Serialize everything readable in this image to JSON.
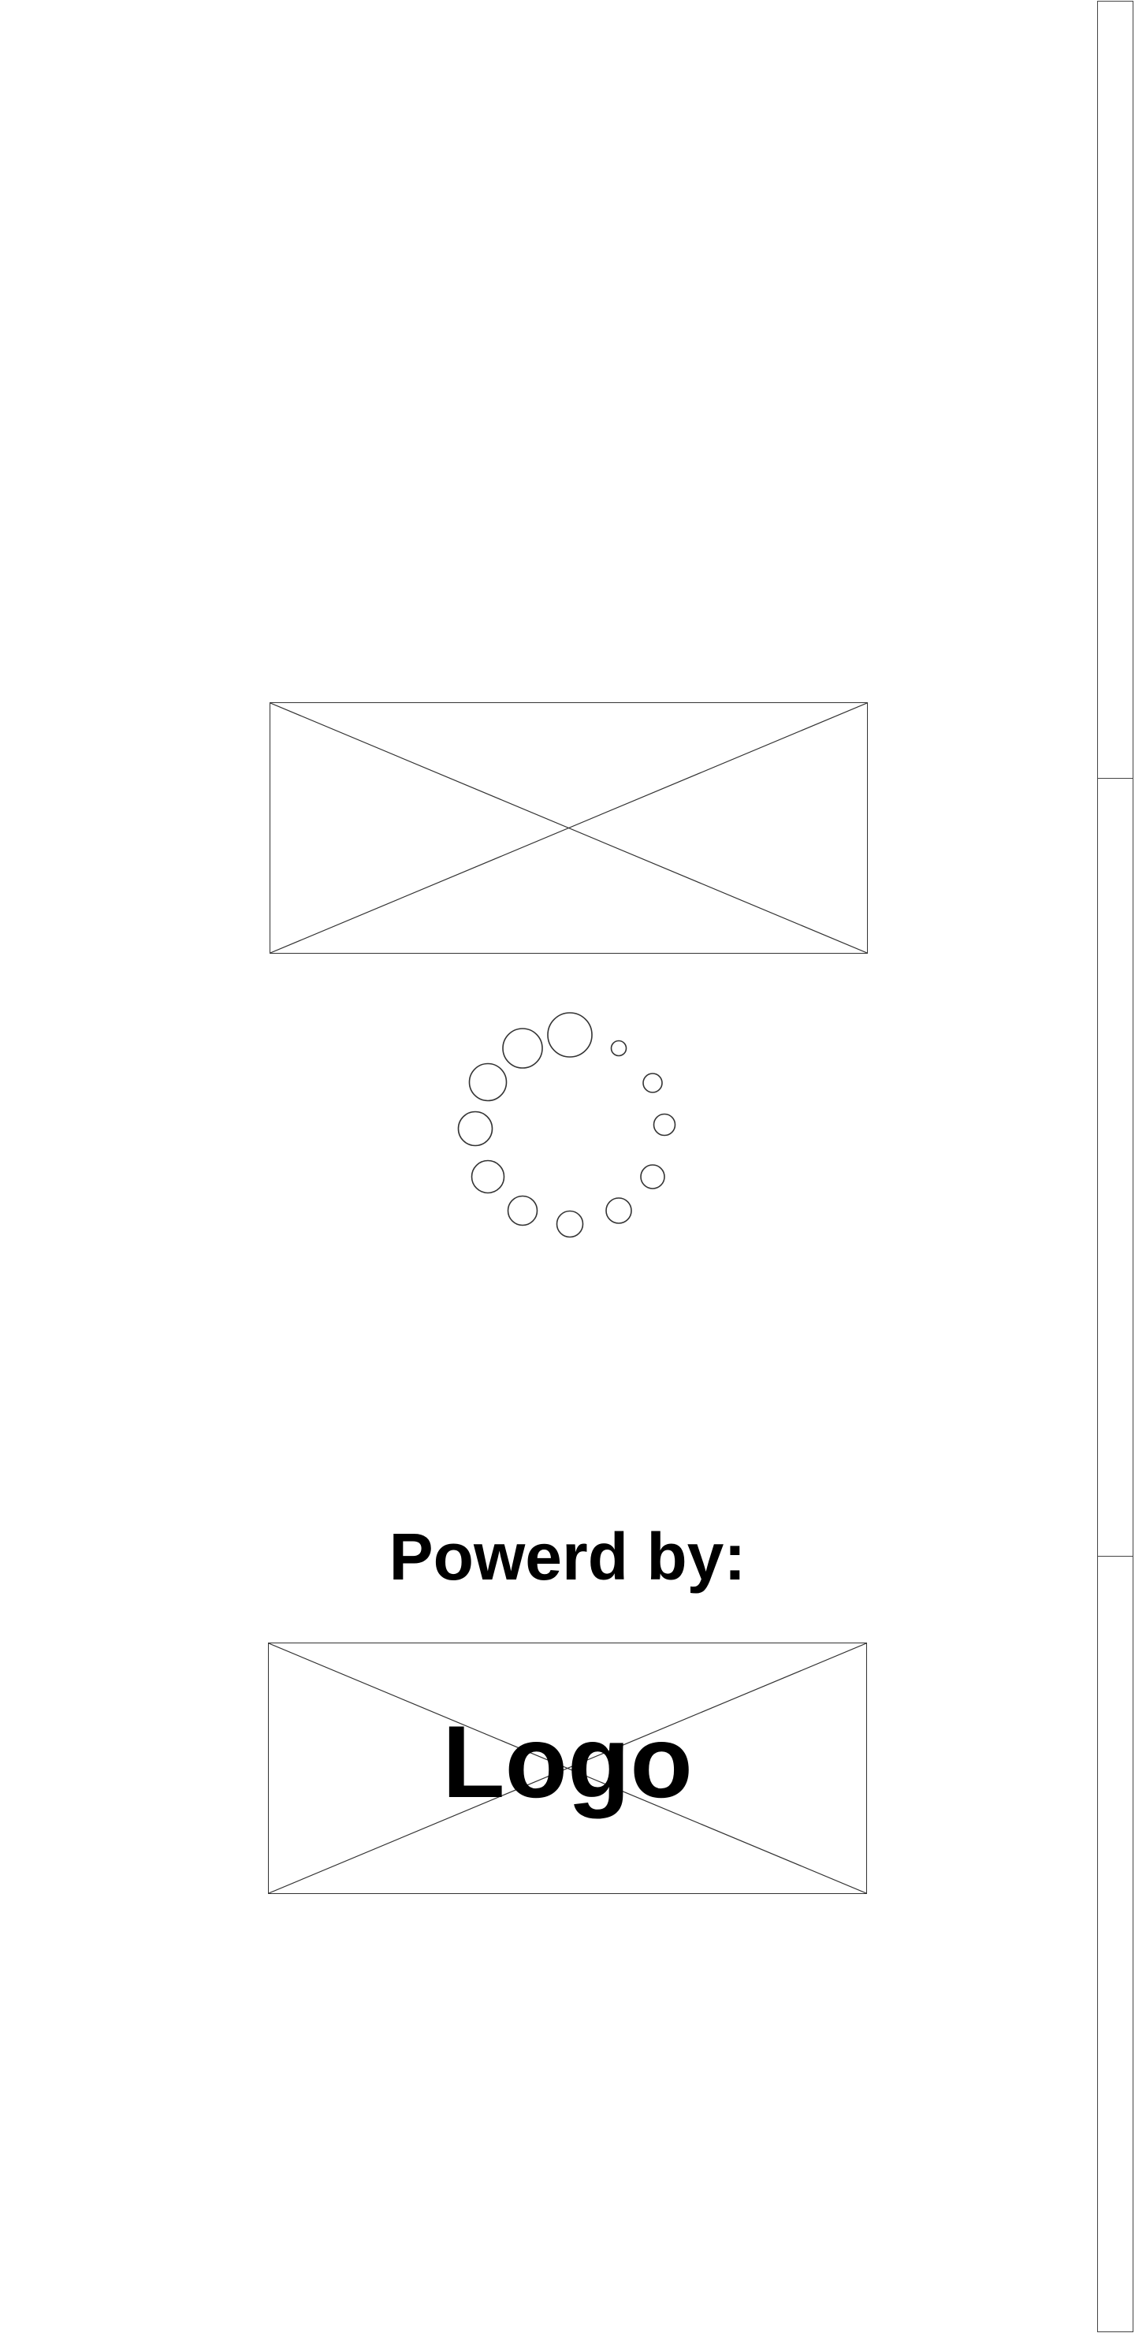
{
  "splash": {
    "hero_image": "image-placeholder",
    "loading_indicator": "loading-spinner",
    "powered_by_label": "Powerd by:",
    "logo_label": "Logo"
  },
  "colors": {
    "background": "#ffffff",
    "text": "#000000",
    "stroke": "#333333"
  }
}
